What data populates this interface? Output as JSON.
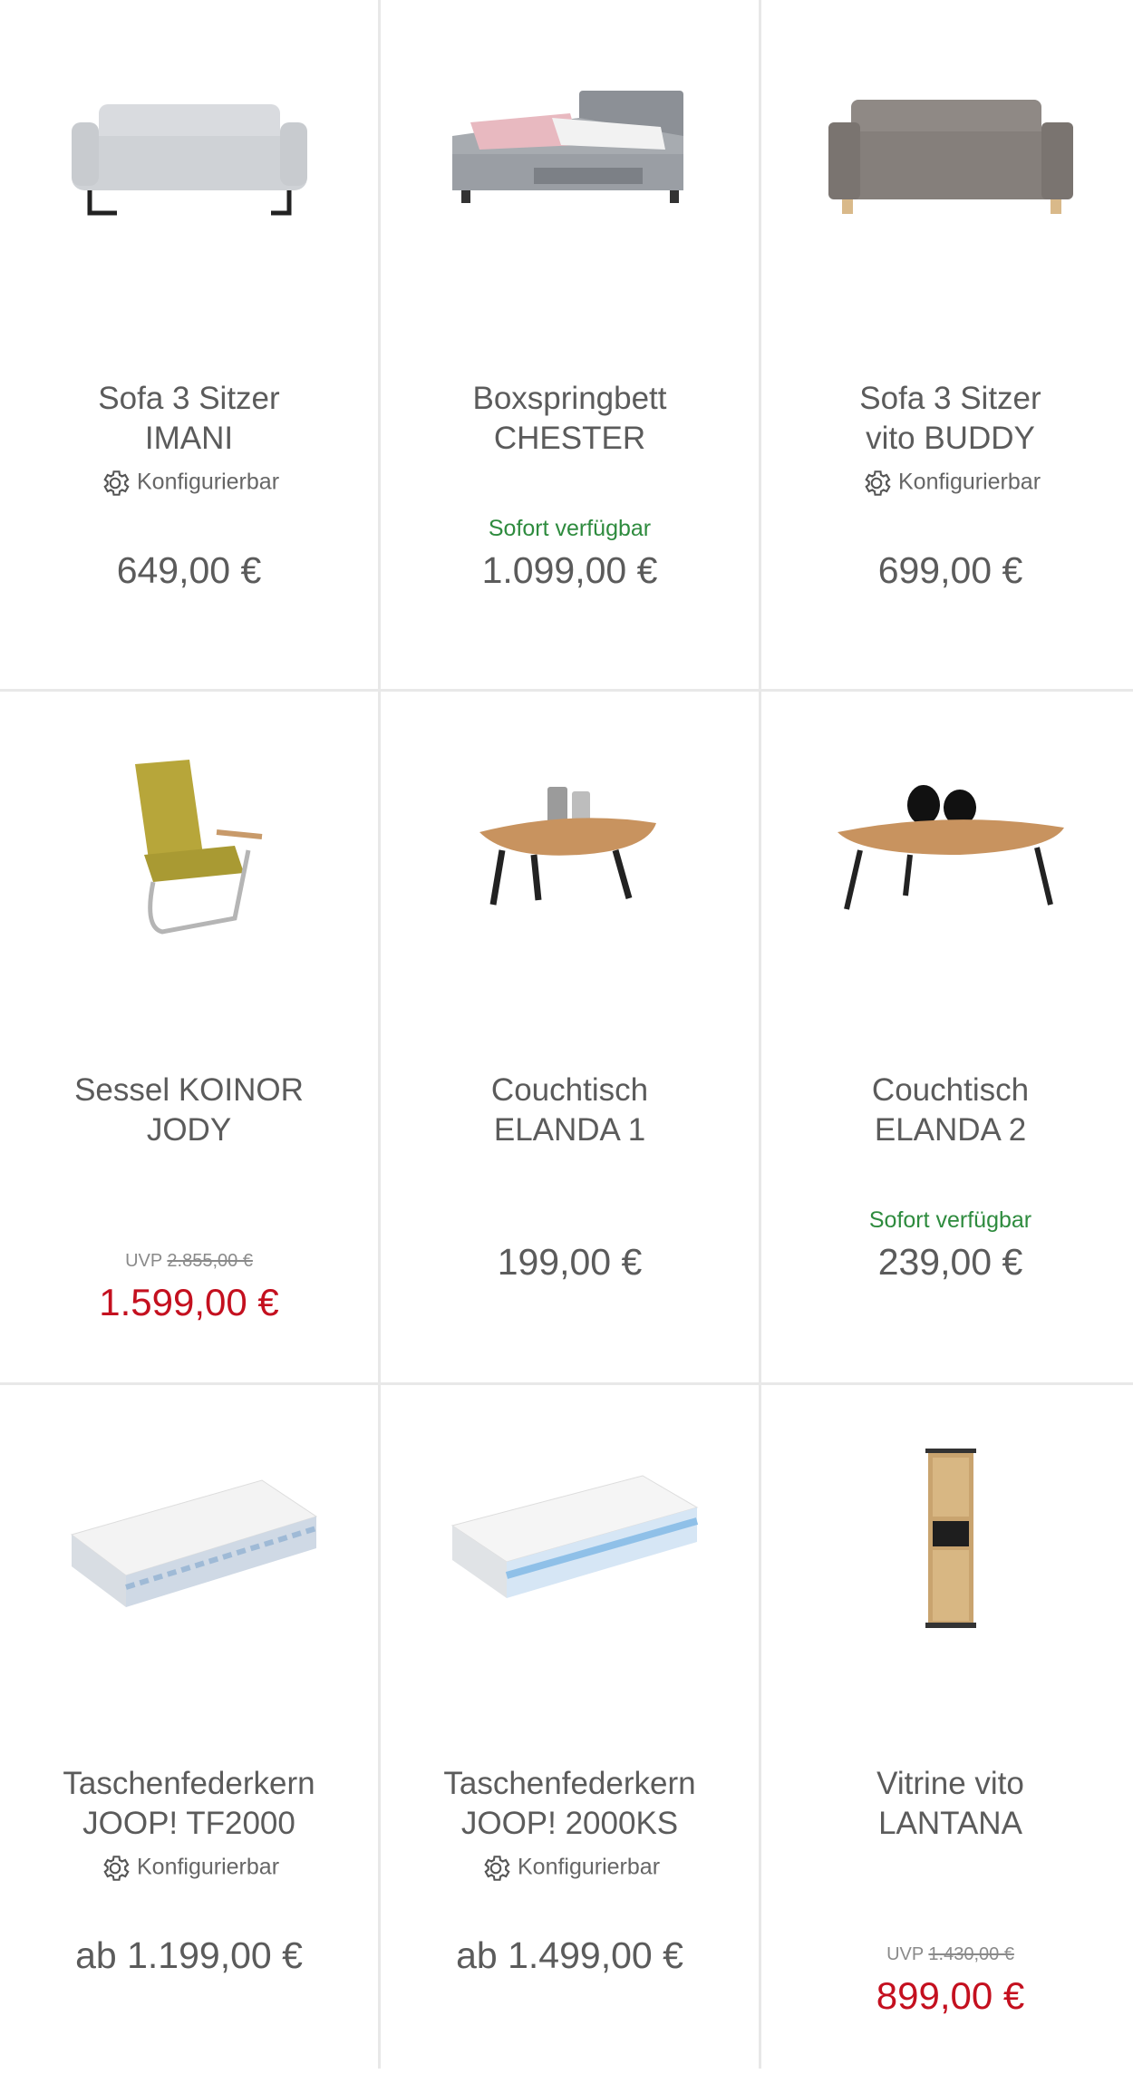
{
  "products": [
    {
      "name_line1": "Sofa 3 Sitzer",
      "name_line2": "IMANI",
      "badge": "Konfigurierbar",
      "price": "649,00 €"
    },
    {
      "name_line1": "Boxspringbett",
      "name_line2": "CHESTER",
      "availability": "Sofort verfügbar",
      "price": "1.099,00 €"
    },
    {
      "name_line1": "Sofa 3 Sitzer",
      "name_line2": "vito BUDDY",
      "badge": "Konfigurierbar",
      "price": "699,00 €"
    },
    {
      "name_line1": "Sessel KOINOR",
      "name_line2": "JODY",
      "uvp_label": "UVP",
      "uvp_price": "2.855,00 €",
      "price": "1.599,00 €"
    },
    {
      "name_line1": "Couchtisch",
      "name_line2": "ELANDA 1",
      "price": "199,00 €"
    },
    {
      "name_line1": "Couchtisch",
      "name_line2": "ELANDA 2",
      "availability": "Sofort verfügbar",
      "price": "239,00 €"
    },
    {
      "name_line1": "Taschenfederkern",
      "name_line2": "JOOP! TF2000",
      "badge": "Konfigurierbar",
      "price": "ab 1.199,00 €"
    },
    {
      "name_line1": "Taschenfederkern",
      "name_line2": "JOOP! 2000KS",
      "badge": "Konfigurierbar",
      "price": "ab 1.499,00 €"
    },
    {
      "name_line1": "Vitrine vito",
      "name_line2": "LANTANA",
      "uvp_label": "UVP",
      "uvp_price": "1.430,00 €",
      "price": "899,00 €"
    }
  ],
  "colors": {
    "availability": "#2e8b3e",
    "sale_price": "#c4101f",
    "divider": "#e8e8e8"
  },
  "icons": {
    "badge_icon": "gear-icon"
  }
}
